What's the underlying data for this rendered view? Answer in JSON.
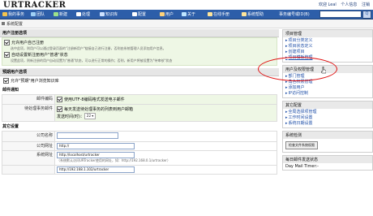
{
  "app": {
    "logo": "URTRACKER"
  },
  "toplinks": [
    "欢迎 Leal",
    "个人信息",
    "注销"
  ],
  "nav": [
    {
      "label": "我的事务",
      "color": "#f4c44e"
    },
    {
      "label": "团队",
      "color": "#9fd0f5"
    },
    {
      "label": "新建",
      "color": "#9de28a"
    },
    {
      "label": "处理",
      "color": "#ffffff"
    },
    {
      "label": "知识库",
      "color": "#cfe3ff"
    },
    {
      "label": "配置",
      "color": "#ffffff"
    },
    {
      "label": "用户",
      "color": "#ffd27a"
    },
    {
      "label": "关于",
      "color": "#bfe6ff"
    },
    {
      "label": "在线手册",
      "color": "#ffe59a"
    },
    {
      "label": "系统帮助",
      "color": "#ffe59a"
    }
  ],
  "search": {
    "label": "事务编号或ID(B)",
    "value": "",
    "button": "Q"
  },
  "breadcrumb": "系统配置",
  "main": {
    "section1": "用户注册选项",
    "reg_opt1": "允许用户自己注册",
    "reg_hint1": "选中此项，则用户可以通过登录页面的\"注册新用户\"链接自己进行注册，否则由系统管理人员添加用户信息。",
    "reg_opt2": "自动设置新注册用户\"普通\"状态",
    "reg_hint2": "设置此项，则新注册的用户自动设置为\"普通\"状态，可以进行正常的操作；否则，新用户将被设置为\"待审核\"状态",
    "section2": "预期用户选项",
    "exp_opt1": "允许\"预期\"用户浏览知识库",
    "section3": "邮件通知",
    "mail_label1": "邮件编码",
    "mail_opt1": "使用UTF-8编码格式发送电子邮件",
    "mail_label2": "待处理事务邮件",
    "mail_opt2": "每天发送待处理事务的列表到用户邮箱",
    "mail_time_label": "发送时间(时)：",
    "mail_time_value": "22",
    "section4": "其它设置",
    "company_label": "公司名称",
    "company_value": "",
    "site_label": "公司网址",
    "site_value": "http://",
    "sys_label": "系统网址",
    "sys_value": "http://localhost/urtracker",
    "sys_hint": "（系统默认访问URTracker使用的网址，如：http://192.168.0.1/urtracker）",
    "ip_value": "http://192.168.1.102/urtracker"
  },
  "sidebar": {
    "project_title": "项目管理",
    "project_items": [
      "项目分类定义",
      "项目状态定义",
      "创建项目",
      "项目模板管理"
    ],
    "user_title": "用户及权限管理",
    "user_items": [
      "部门管理",
      "角色权限管理",
      "添加用户",
      "IP访问控制"
    ],
    "other_title": "其它配置",
    "other_items": [
      "全局选择项管理",
      "工作时间设置",
      "系统日期设置"
    ],
    "check_title": "系统检测",
    "check_button": "检查文件系统权限",
    "daily_title": "每日邮件发送状态",
    "daily_label": "Day Mail Timer:-"
  }
}
